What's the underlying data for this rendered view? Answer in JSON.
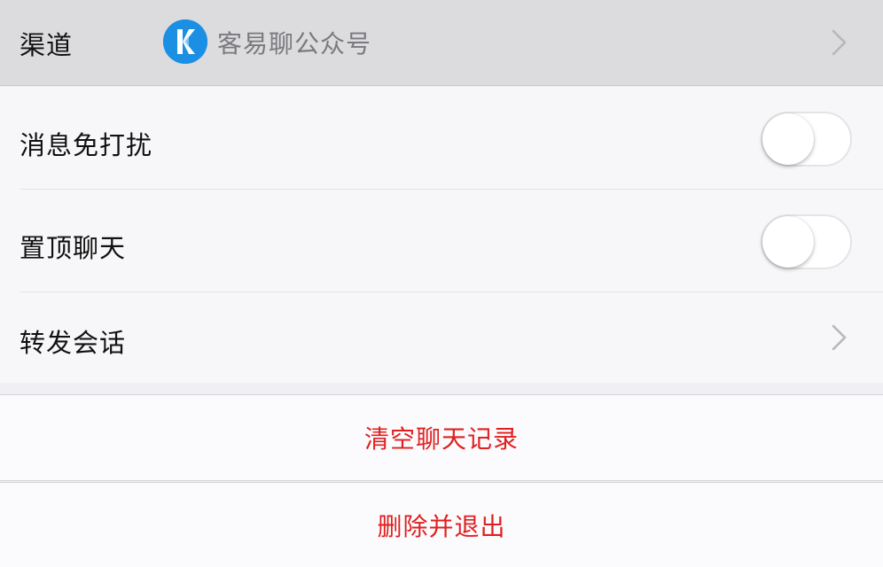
{
  "channel": {
    "label": "渠道",
    "name": "客易聊公众号",
    "logo_color": "#1a8fe3"
  },
  "settings": {
    "mute": {
      "label": "消息免打扰",
      "enabled": false
    },
    "pin_top": {
      "label": "置顶聊天",
      "enabled": false
    },
    "forward": {
      "label": "转发会话"
    }
  },
  "actions": {
    "clear_history": "清空聊天记录",
    "delete_exit": "删除并退出",
    "danger_color": "#e02020"
  }
}
